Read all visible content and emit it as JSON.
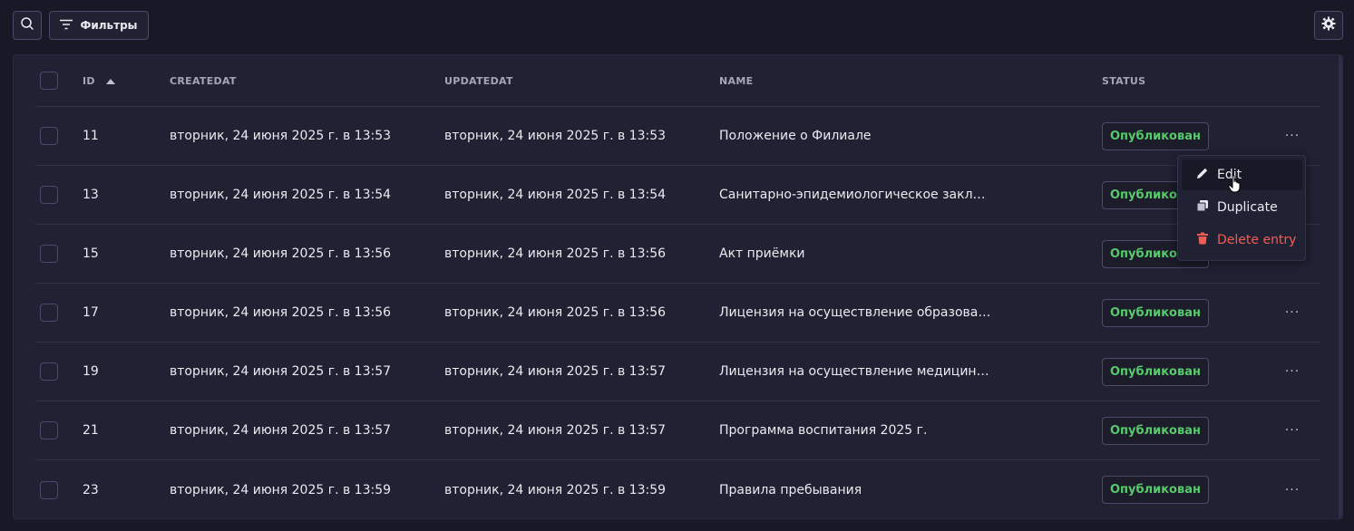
{
  "toolbar": {
    "search_icon": "search-icon",
    "filters_label": "Фильтры",
    "settings_icon": "gear-icon"
  },
  "table": {
    "headers": {
      "id": "ID",
      "createdAt": "CREATEDAT",
      "updatedAt": "UPDATEDAT",
      "name": "NAME",
      "status": "STATUS"
    },
    "sort_indicator": "caret-up-icon",
    "rows": [
      {
        "id": "11",
        "createdAt": "вторник, 24 июня 2025 г. в 13:53",
        "updatedAt": "вторник, 24 июня 2025 г. в 13:53",
        "name": "Положение о Филиале",
        "status": "Опубликован"
      },
      {
        "id": "13",
        "createdAt": "вторник, 24 июня 2025 г. в 13:54",
        "updatedAt": "вторник, 24 июня 2025 г. в 13:54",
        "name": "Санитарно-эпидемиологическое заключен…",
        "status": "Опубликован"
      },
      {
        "id": "15",
        "createdAt": "вторник, 24 июня 2025 г. в 13:56",
        "updatedAt": "вторник, 24 июня 2025 г. в 13:56",
        "name": "Акт приёмки",
        "status": "Опубликован"
      },
      {
        "id": "17",
        "createdAt": "вторник, 24 июня 2025 г. в 13:56",
        "updatedAt": "вторник, 24 июня 2025 г. в 13:56",
        "name": "Лицензия на осуществление образовательн…",
        "status": "Опубликован"
      },
      {
        "id": "19",
        "createdAt": "вторник, 24 июня 2025 г. в 13:57",
        "updatedAt": "вторник, 24 июня 2025 г. в 13:57",
        "name": "Лицензия на осуществление медицинской д…",
        "status": "Опубликован"
      },
      {
        "id": "21",
        "createdAt": "вторник, 24 июня 2025 г. в 13:57",
        "updatedAt": "вторник, 24 июня 2025 г. в 13:57",
        "name": "Программа воспитания 2025 г.",
        "status": "Опубликован"
      },
      {
        "id": "23",
        "createdAt": "вторник, 24 июня 2025 г. в 13:59",
        "updatedAt": "вторник, 24 июня 2025 г. в 13:59",
        "name": "Правила пребывания",
        "status": "Опубликован"
      }
    ],
    "more_label": "···"
  },
  "context_menu": {
    "items": [
      {
        "label": "Edit",
        "icon": "pencil-icon"
      },
      {
        "label": "Duplicate",
        "icon": "duplicate-icon"
      },
      {
        "label": "Delete entry",
        "icon": "trash-icon"
      }
    ]
  },
  "colors": {
    "background": "#181826",
    "card": "#212134",
    "status_published": "#55cb6a",
    "danger": "#ee5e52"
  }
}
